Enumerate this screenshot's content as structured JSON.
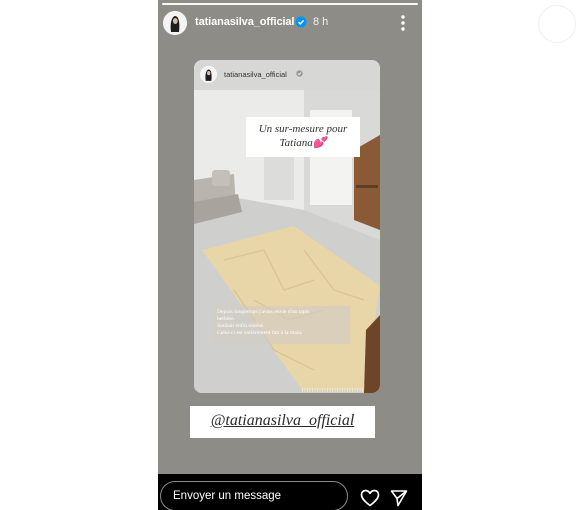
{
  "story": {
    "username": "tatianasilva_official",
    "timestamp": "8 h"
  },
  "repost": {
    "username": "tatianasilva_official",
    "title_sticker": [
      "Un sur-mesure pour",
      "Tatiana💕"
    ],
    "caption_lines": [
      "Depuis longtemps j'avais envie d'un tapis",
      "berbère.",
      "Souhait enfin réalisé.",
      "Celui-ci est entièrement fait à la main."
    ]
  },
  "mention_sticker": "@tatianasilva_official",
  "footer": {
    "message_placeholder": "Envoyer un message"
  },
  "icons": {
    "verified": "verified-badge-icon",
    "more": "more-vertical-icon",
    "like": "heart-icon",
    "share": "send-icon"
  },
  "colors": {
    "story_background": "#8e8c87",
    "footer_background": "#000000",
    "verified_blue": "#0095f6",
    "rug_cream": "#e8d5a8"
  }
}
